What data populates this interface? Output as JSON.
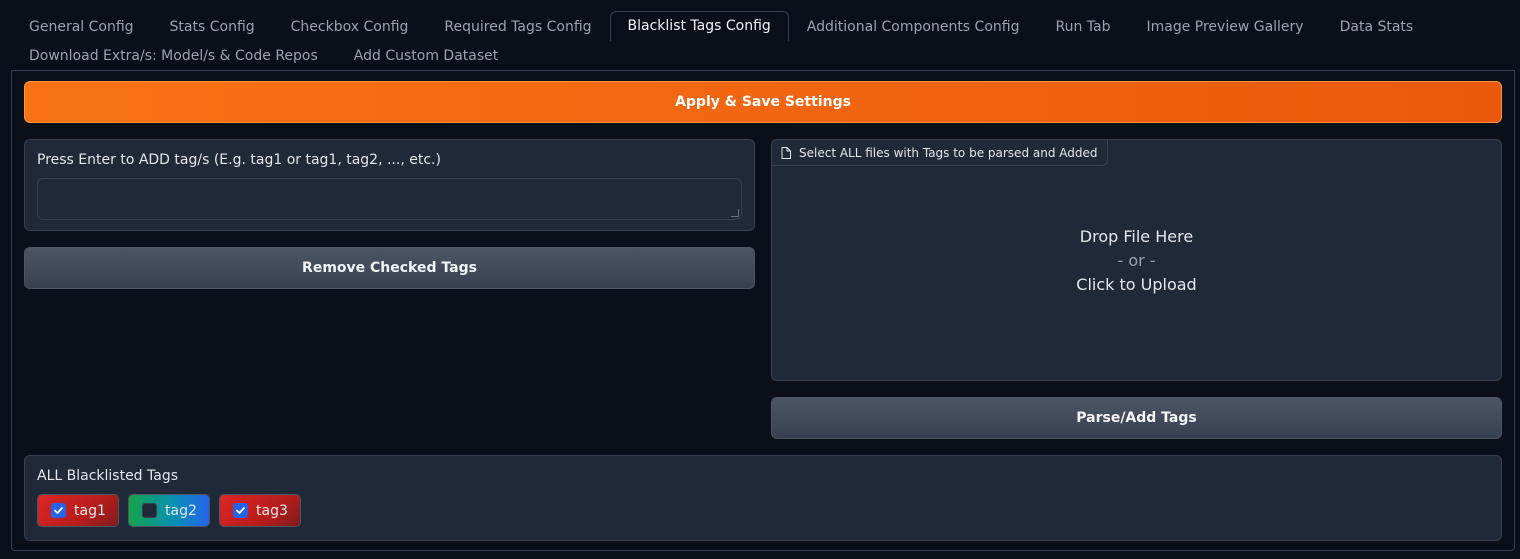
{
  "tabs": {
    "row1": [
      {
        "label": "General Config",
        "active": false
      },
      {
        "label": "Stats Config",
        "active": false
      },
      {
        "label": "Checkbox Config",
        "active": false
      },
      {
        "label": "Required Tags Config",
        "active": false
      },
      {
        "label": "Blacklist Tags Config",
        "active": true
      },
      {
        "label": "Additional Components Config",
        "active": false
      },
      {
        "label": "Run Tab",
        "active": false
      },
      {
        "label": "Image Preview Gallery",
        "active": false
      },
      {
        "label": "Data Stats",
        "active": false
      }
    ],
    "row2": [
      {
        "label": "Download Extra/s: Model/s & Code Repos",
        "active": false
      },
      {
        "label": "Add Custom Dataset",
        "active": false
      }
    ]
  },
  "main": {
    "apply_button": "Apply & Save Settings",
    "tag_input": {
      "label": "Press Enter to ADD tag/s (E.g. tag1 or tag1, tag2, ..., etc.)",
      "value": ""
    },
    "remove_button": "Remove Checked Tags",
    "upload": {
      "label": "Select ALL files with Tags to be parsed and Added",
      "icon": "file-icon",
      "drop_text": "Drop File Here",
      "or_text": "- or -",
      "click_text": "Click to Upload"
    },
    "parse_button": "Parse/Add Tags",
    "blacklist": {
      "label": "ALL Blacklisted Tags",
      "tags": [
        {
          "name": "tag1",
          "checked": true,
          "style": "red"
        },
        {
          "name": "tag2",
          "checked": false,
          "style": "rgb"
        },
        {
          "name": "tag3",
          "checked": true,
          "style": "red"
        }
      ]
    }
  },
  "colors": {
    "background": "#0b0f19",
    "block": "#1f2937",
    "border": "#374151",
    "primary": "#f97316",
    "checkbox_checked": "#2563eb"
  }
}
